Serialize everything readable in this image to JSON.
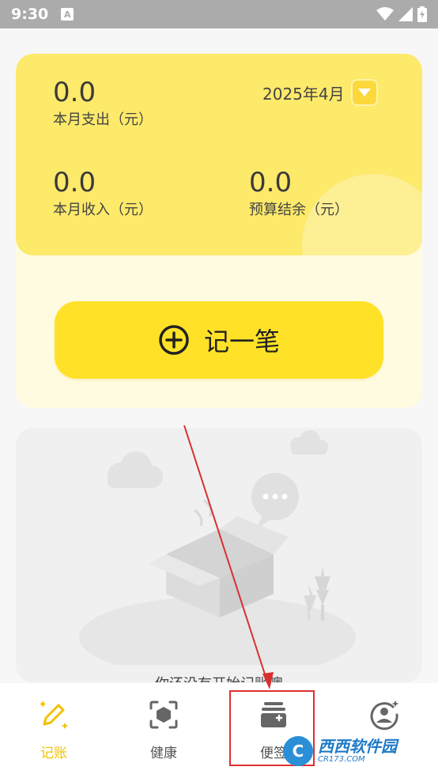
{
  "status_bar": {
    "time": "9:30",
    "notification_badge": "A"
  },
  "summary": {
    "expense_value": "0.0",
    "expense_label": "本月支出（元）",
    "income_value": "0.0",
    "income_label": "本月收入（元）",
    "budget_value": "0.0",
    "budget_label": "预算结余（元）",
    "month": "2025年4月"
  },
  "record_button": {
    "label": "记一笔"
  },
  "empty_state": {
    "text": "你还没有开始记账噢"
  },
  "bottom_nav": {
    "items": [
      {
        "label": "记账",
        "icon": "pen-sparkle-icon",
        "active": true
      },
      {
        "label": "健康",
        "icon": "scan-box-icon",
        "active": false
      },
      {
        "label": "便签",
        "icon": "note-stack-icon",
        "active": false
      },
      {
        "label": "",
        "icon": "user-star-icon",
        "active": false
      }
    ]
  },
  "watermark": {
    "main": "西西软件园",
    "sub": "CR173.COM"
  },
  "colors": {
    "accent_yellow": "#ffe227",
    "card_yellow": "#fde96a",
    "card_light": "#fffbe0",
    "annotation_red": "#e03030"
  }
}
